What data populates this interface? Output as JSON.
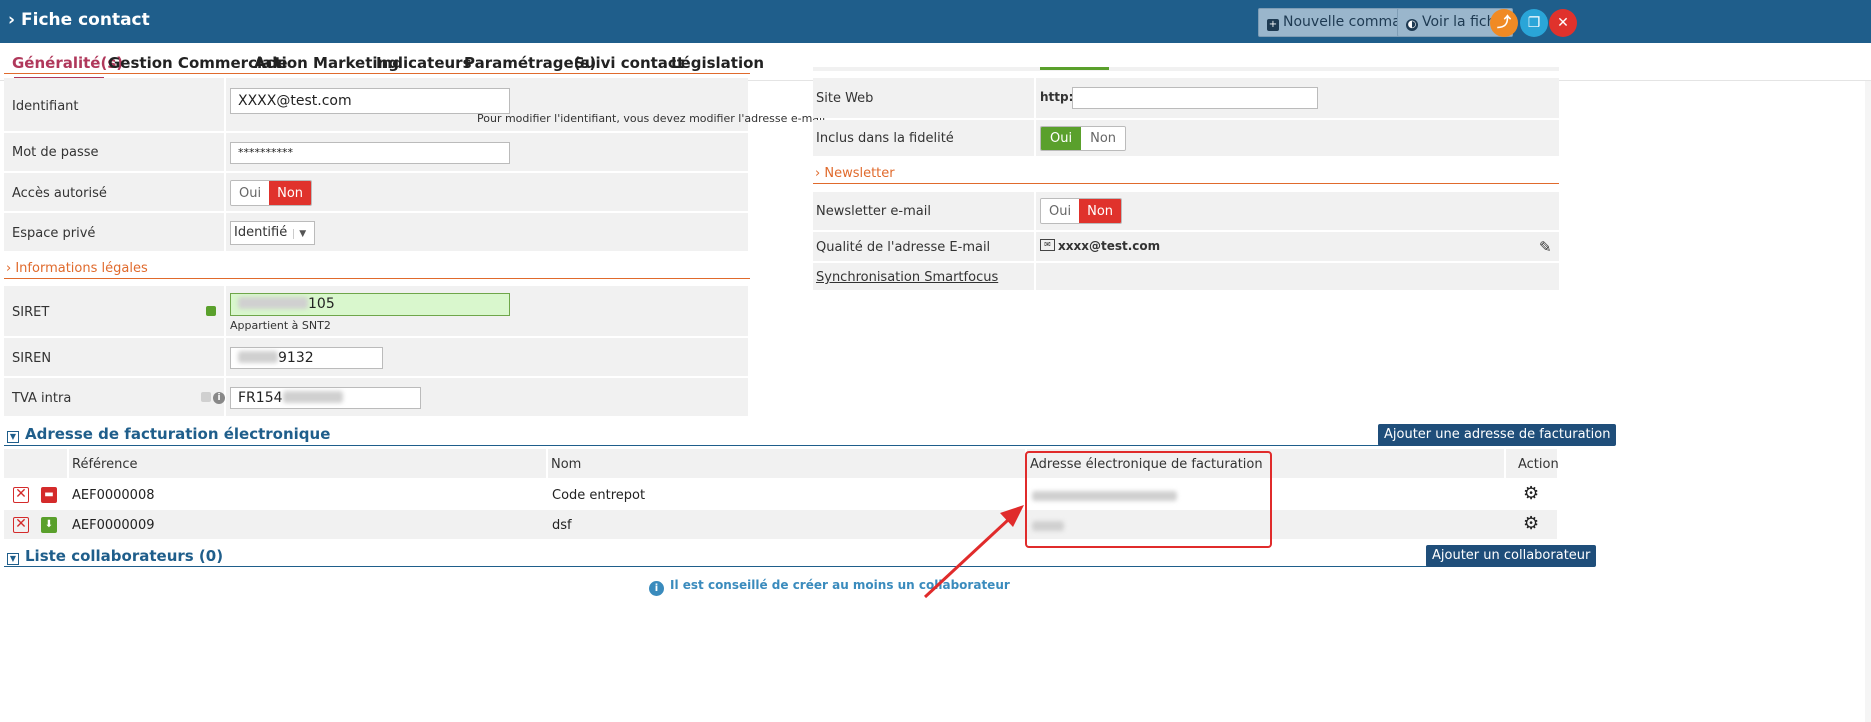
{
  "header": {
    "title": "Fiche contact",
    "new_order": "Nouvelle commande",
    "view_sheet": "Voir la fiche",
    "colors": {
      "bar": "#1f5e8b",
      "share": "#f08a24",
      "copy": "#2aa5d8",
      "close": "#e0322c"
    }
  },
  "tabs": [
    "Généralité(s)",
    "Gestion Commerciale",
    "Action Marketing",
    "Indicateurs",
    "Paramétrage(s)",
    "Suivi contact",
    "Législation"
  ],
  "left": {
    "identifiant_label": "Identifiant",
    "identifiant_value": "XXXX@test.com",
    "identifiant_hint": "Pour modifier l'identifiant, vous devez modifier l'adresse e-mail",
    "password_label": "Mot de passe",
    "password_value": "**********",
    "access_label": "Accès autorisé",
    "private_label": "Espace privé",
    "private_value": "Identifié",
    "legal_section": "Informations légales",
    "siret_label": "SIRET",
    "siret_value": "105",
    "siret_hint": "Appartient à SNT2",
    "siren_label": "SIREN",
    "siren_value": "9132",
    "tva_label": "TVA intra",
    "tva_value": "FR154"
  },
  "right": {
    "site_label": "Site Web",
    "site_prefix": "http://",
    "loyalty_label": "Inclus dans la fidelité",
    "newsletter_section": "Newsletter",
    "newsletter_label": "Newsletter e-mail",
    "email_quality_label": "Qualité de l'adresse E-mail",
    "email_quality_value": "xxxx@test.com",
    "sync_label": "Synchronisation Smartfocus"
  },
  "toggles": {
    "yes": "Oui",
    "no": "Non"
  },
  "billing": {
    "title": "Adresse de facturation électronique",
    "add_button": "Ajouter une adresse de facturation",
    "columns": [
      "Référence",
      "Nom",
      "Adresse électronique de facturation",
      "Action"
    ],
    "rows": [
      {
        "ref": "AEF0000008",
        "name": "Code entrepot"
      },
      {
        "ref": "AEF0000009",
        "name": "dsf"
      }
    ]
  },
  "collaborators": {
    "title": "Liste collaborateurs (0)",
    "add_button": "Ajouter un collaborateur",
    "notice": "Il est conseillé de créer au moins un collaborateur"
  }
}
